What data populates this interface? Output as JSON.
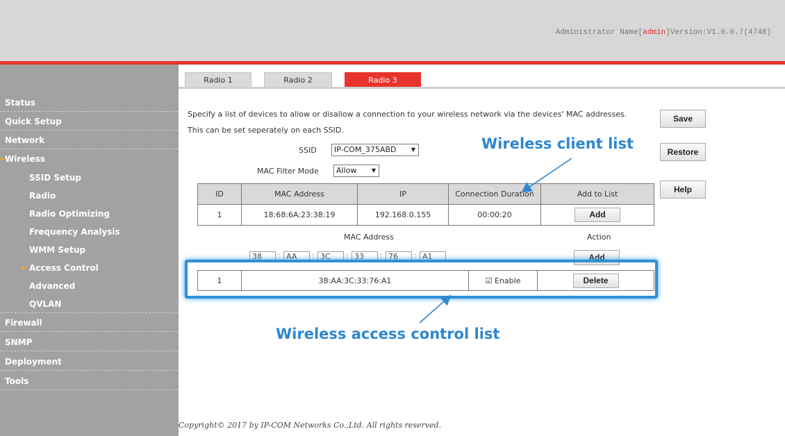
{
  "header": {
    "admin_prefix": "Administrator Name[",
    "admin_name": "admin",
    "version_text": "]Version:V1.0.0.7(4748)"
  },
  "sidebar": {
    "items": [
      {
        "label": "Status",
        "type": "top"
      },
      {
        "label": "Quick Setup",
        "type": "top"
      },
      {
        "label": "Network",
        "type": "top"
      },
      {
        "label": "Wireless",
        "type": "top",
        "expanded": true
      },
      {
        "label": "SSID Setup",
        "type": "sub"
      },
      {
        "label": "Radio",
        "type": "sub"
      },
      {
        "label": "Radio Optimizing",
        "type": "sub"
      },
      {
        "label": "Frequency Analysis",
        "type": "sub"
      },
      {
        "label": "WMM Setup",
        "type": "sub"
      },
      {
        "label": "Access Control",
        "type": "sub",
        "selected": true
      },
      {
        "label": "Advanced",
        "type": "sub"
      },
      {
        "label": "QVLAN",
        "type": "sub"
      },
      {
        "label": "Firewall",
        "type": "top"
      },
      {
        "label": "SNMP",
        "type": "top"
      },
      {
        "label": "Deployment",
        "type": "top"
      },
      {
        "label": "Tools",
        "type": "top"
      }
    ]
  },
  "tabs": [
    {
      "label": "Radio 1",
      "active": false
    },
    {
      "label": "Radio 2",
      "active": false
    },
    {
      "label": "Radio 3",
      "active": true
    }
  ],
  "description": {
    "line1": "Specify a list of devices to allow or disallow a connection to your wireless network via the devices' MAC addresses.",
    "line2": "This can be set seperately on each SSID."
  },
  "ssid": {
    "label": "SSID",
    "value": "IP-COM_375ABD"
  },
  "mac_filter": {
    "label": "MAC Filter Mode",
    "value": "Allow"
  },
  "client_table": {
    "headers": [
      "ID",
      "MAC Address",
      "IP",
      "Connection Duration",
      "Add to List"
    ],
    "rows": [
      {
        "id": "1",
        "mac": "18:68:6A:23:38:19",
        "ip": "192.168.0.155",
        "duration": "00:00:20",
        "action": "Add"
      }
    ]
  },
  "manual_add": {
    "mac_label": "MAC Address",
    "action_label": "Action",
    "octets": [
      "38",
      "AA",
      "3C",
      "33",
      "76",
      "A1"
    ],
    "add_button": "Add"
  },
  "acl_table": {
    "rows": [
      {
        "id": "1",
        "mac": "38:AA:3C:33:76:A1",
        "enable_label": "Enable",
        "enabled": true,
        "delete_button": "Delete"
      }
    ]
  },
  "buttons": {
    "save": "Save",
    "restore": "Restore",
    "help": "Help"
  },
  "annotations": {
    "client_list": "Wireless client list",
    "access_control_list": "Wireless access control list"
  },
  "footer": "Copyright© 2017 by IP-COM Networks Co.,Ltd. All rights reserved.",
  "colors": {
    "accent_red": "#e8332c",
    "annotation_blue": "#2e86d0",
    "sidebar_gray": "#a2a2a2"
  }
}
